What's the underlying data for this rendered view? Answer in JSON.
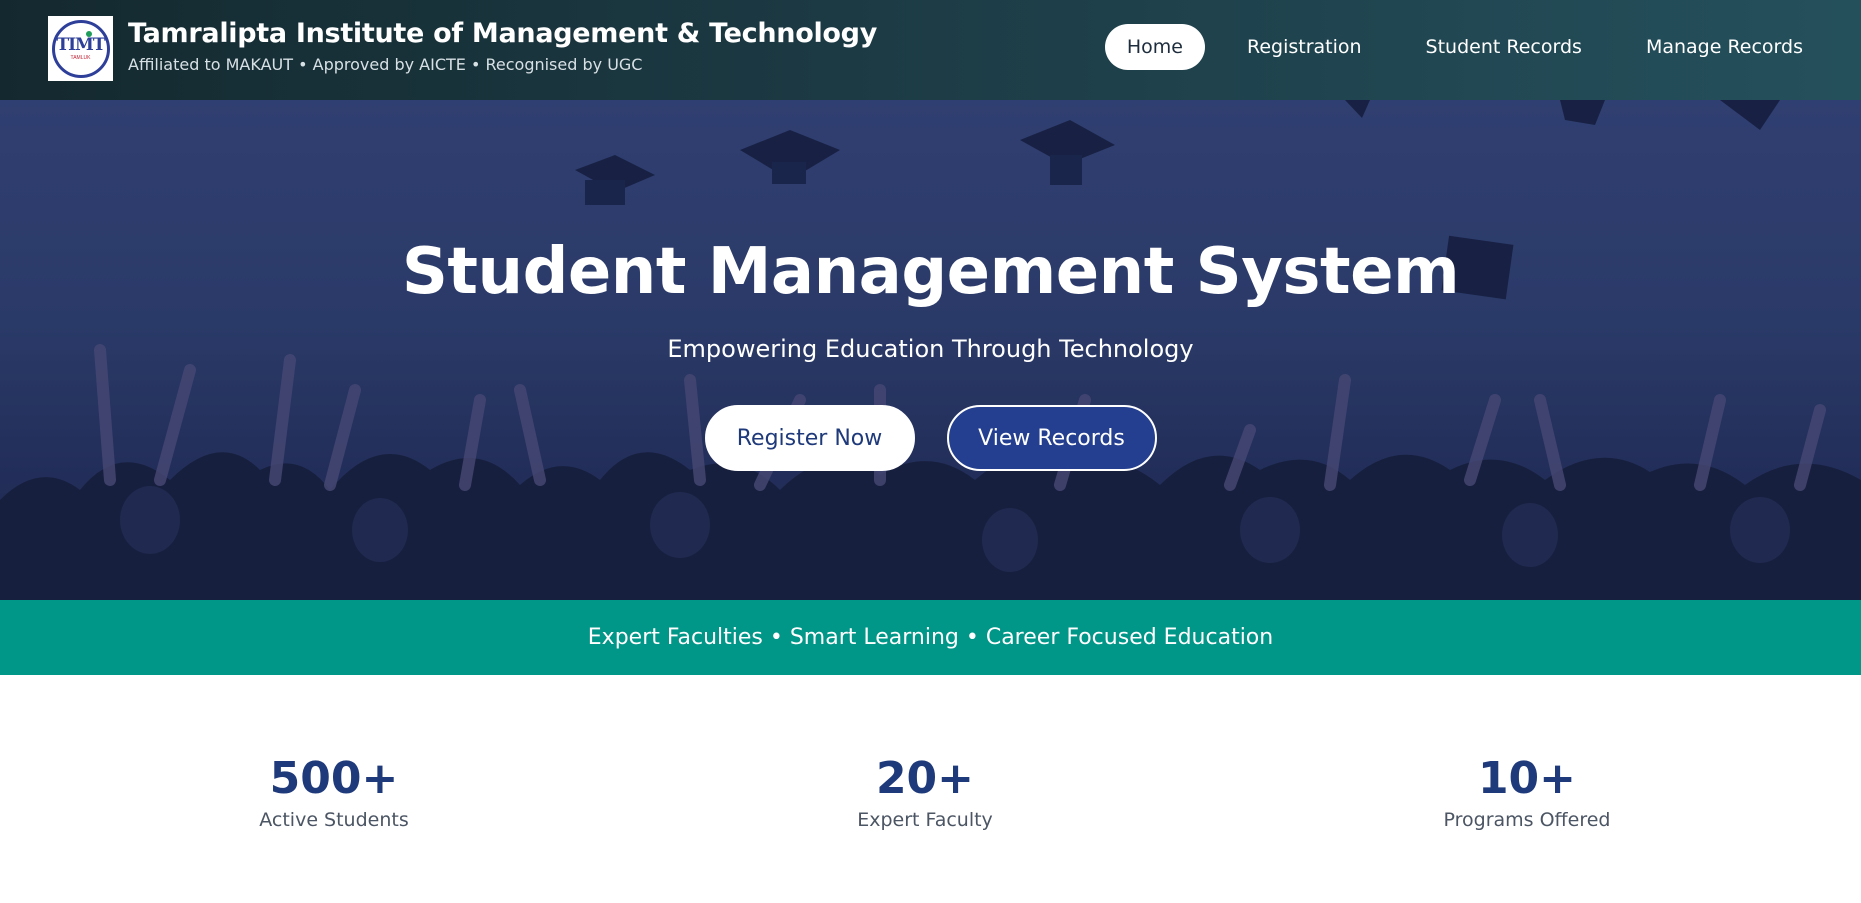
{
  "header": {
    "logo_text": "TIMT",
    "logo_subtext": "TAMLUK",
    "title": "Tamralipta Institute of Management & Technology",
    "subtitle": "Affiliated to MAKAUT  •  Approved by AICTE  •  Recognised by UGC"
  },
  "nav": {
    "items": [
      {
        "label": "Home",
        "active": true
      },
      {
        "label": "Registration",
        "active": false
      },
      {
        "label": "Student Records",
        "active": false
      },
      {
        "label": "Manage Records",
        "active": false
      }
    ]
  },
  "hero": {
    "title": "Student Management System",
    "subtitle": "Empowering Education Through Technology",
    "primary_button": "Register Now",
    "secondary_button": "View Records"
  },
  "strip": {
    "text": "Expert Faculties • Smart Learning • Career Focused Education"
  },
  "stats": [
    {
      "value": "500+",
      "label": "Active Students"
    },
    {
      "value": "20+",
      "label": "Expert Faculty"
    },
    {
      "value": "10+",
      "label": "Programs Offered"
    }
  ],
  "colors": {
    "header_bg": "#1c3a44",
    "hero_bg": "#324270",
    "accent_teal": "#009688",
    "brand_blue": "#1f3a7a",
    "button_blue": "#243f8f"
  }
}
